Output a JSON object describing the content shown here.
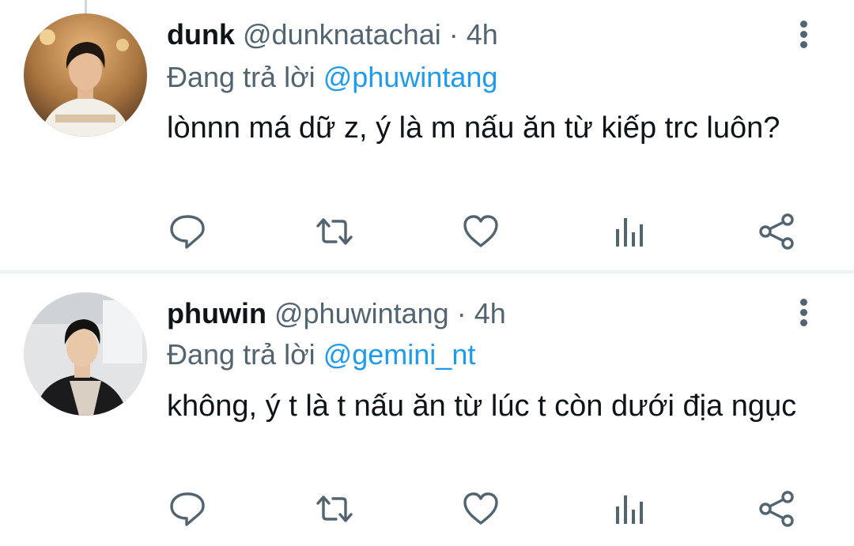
{
  "tweets": [
    {
      "display_name": "dunk",
      "handle": "@dunknatachai",
      "separator": "·",
      "time": "4h",
      "replying_prefix": "Đang trả lời",
      "replying_to": "@phuwintang",
      "text": "lònnn má dữ z, ý là m nấu ăn từ kiếp trc luôn?",
      "actions": [
        "reply-icon",
        "retweet-icon",
        "like-icon",
        "analytics-icon",
        "share-icon"
      ]
    },
    {
      "display_name": "phuwin",
      "handle": "@phuwintang",
      "separator": "·",
      "time": "4h",
      "replying_prefix": "Đang trả lời",
      "replying_to": "@gemini_nt",
      "text": "không, ý t là t nấu ăn từ lúc t còn dưới địa ngục",
      "actions": [
        "reply-icon",
        "retweet-icon",
        "like-icon",
        "analytics-icon",
        "share-icon"
      ]
    }
  ],
  "colors": {
    "text_primary": "#0f1419",
    "text_secondary": "#536471",
    "mention": "#1d9bf0",
    "divider": "#eff3f4"
  }
}
